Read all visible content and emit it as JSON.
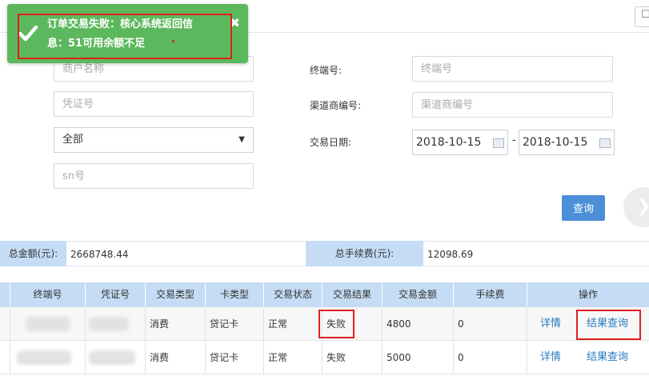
{
  "toast": {
    "line1": "订单交易失败：核心系统返回信",
    "line2": "息：51可用余额不足",
    "close": "✖",
    "color": "#5cb85c"
  },
  "filters": {
    "merchant_placeholder": "商户名称",
    "terminal_label": "终端号:",
    "terminal_placeholder": "终端号",
    "voucher_placeholder": "凭证号",
    "channel_label": "渠道商编号:",
    "channel_placeholder": "渠道商编号",
    "type_selected": "全部",
    "date_label": "交易日期:",
    "date_from": "2018-10-15",
    "date_sep": "-",
    "date_to": "2018-10-15",
    "sn_placeholder": "sn号",
    "query_button": "查询"
  },
  "summary": {
    "total_amount_label": "总金额(元):",
    "total_amount_value": "2668748.44",
    "total_fee_label": "总手续费(元):",
    "total_fee_value": "12098.69"
  },
  "table": {
    "headers": [
      "终端号",
      "凭证号",
      "交易类型",
      "卡类型",
      "交易状态",
      "交易结果",
      "交易金额",
      "手续费",
      "操作"
    ],
    "rows": [
      {
        "terminal": "",
        "voucher": "",
        "txn_type": "消费",
        "card_type": "贷记卡",
        "status": "正常",
        "result": "失败",
        "amount": "4800",
        "fee": "0",
        "detail": "详情",
        "result_query": "结果查询"
      },
      {
        "terminal": "",
        "voucher": "",
        "txn_type": "消费",
        "card_type": "贷记卡",
        "status": "正常",
        "result": "失败",
        "amount": "5000",
        "fee": "0",
        "detail": "详情",
        "result_query": "结果查询"
      }
    ]
  },
  "colors": {
    "header_bg": "#c5dcf4",
    "button_bg": "#4a8fd8",
    "link": "#2a7bc1",
    "highlight": "#e02020"
  }
}
